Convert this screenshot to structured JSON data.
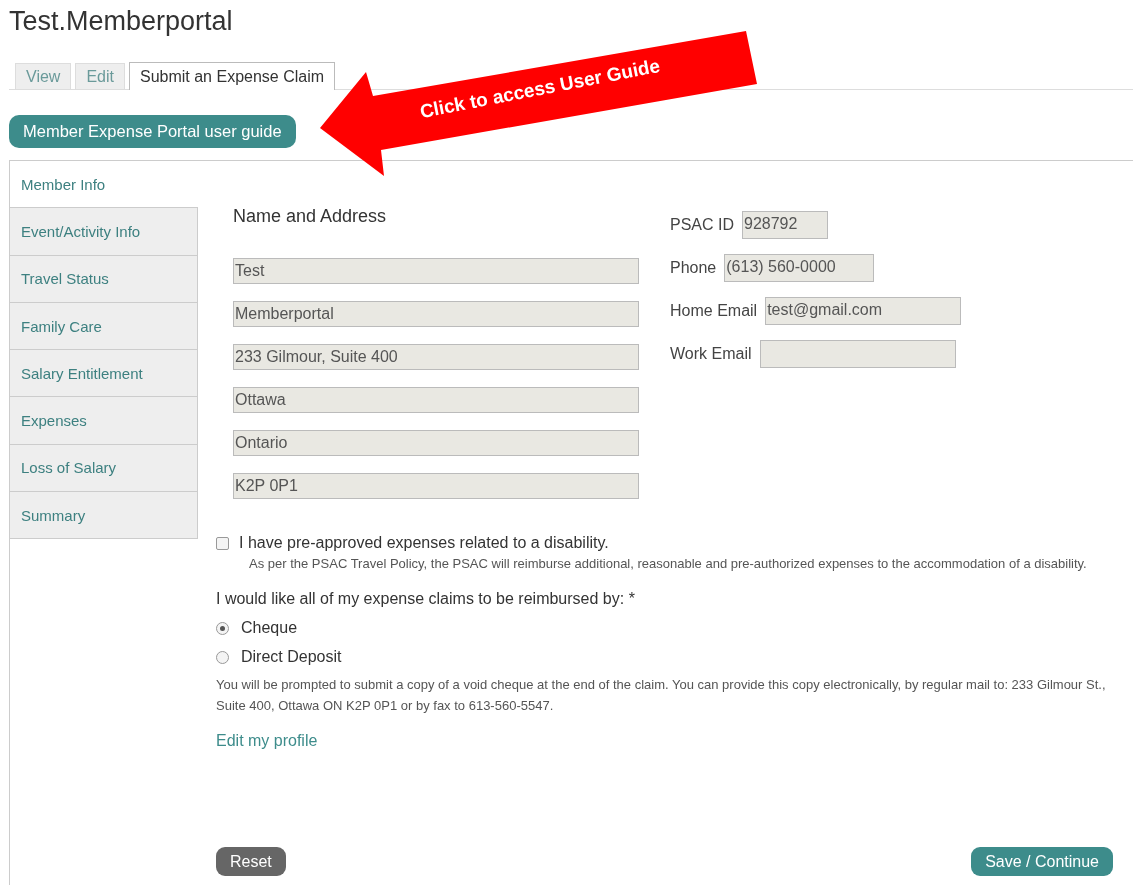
{
  "title": "Test.Memberportal",
  "tabs": [
    {
      "label": "View",
      "selected": false
    },
    {
      "label": "Edit",
      "selected": false
    },
    {
      "label": "Submit an Expense Claim",
      "selected": true
    }
  ],
  "guide_button": "Member Expense Portal user guide",
  "annotation": {
    "text": "Click to access User Guide"
  },
  "steps": [
    {
      "label": "Member Info",
      "selected": true
    },
    {
      "label": "Event/Activity Info",
      "selected": false
    },
    {
      "label": "Travel Status",
      "selected": false
    },
    {
      "label": "Family Care",
      "selected": false
    },
    {
      "label": "Salary Entitlement",
      "selected": false
    },
    {
      "label": "Expenses",
      "selected": false
    },
    {
      "label": "Loss of Salary",
      "selected": false
    },
    {
      "label": "Summary",
      "selected": false
    }
  ],
  "name_address": {
    "heading": "Name and Address",
    "fields": [
      {
        "value": "Test"
      },
      {
        "value": "Memberportal"
      },
      {
        "value": "233 Gilmour, Suite 400"
      },
      {
        "value": "Ottawa"
      },
      {
        "value": "Ontario"
      },
      {
        "value": "K2P 0P1"
      }
    ]
  },
  "contact": [
    {
      "label": "PSAC ID",
      "value": "928792"
    },
    {
      "label": "Phone",
      "value": "(613) 560-0000"
    },
    {
      "label": "Home Email",
      "value": "test@gmail.com"
    },
    {
      "label": "Work Email"
    }
  ],
  "disability": {
    "label": "I have pre-approved expenses related to a disability.",
    "checked": false,
    "note": "As per the PSAC Travel Policy, the PSAC will reimburse additional, reasonable and pre-authorized expenses to the accommodation of a disability."
  },
  "reimburse": {
    "question": "I would like all of my expense claims to be reimbursed by: *",
    "options": [
      {
        "label": "Cheque",
        "selected": true
      },
      {
        "label": "Direct Deposit",
        "selected": false
      }
    ],
    "note": "You will be prompted to submit a copy of a void cheque at the end of the claim. You can provide this copy electronically, by regular mail to: 233 Gilmour St., Suite 400, Ottawa ON K2P 0P1 or by fax to 613-560-5547."
  },
  "edit_link": "Edit my profile",
  "buttons": {
    "reset": "Reset",
    "save": "Save / Continue"
  }
}
